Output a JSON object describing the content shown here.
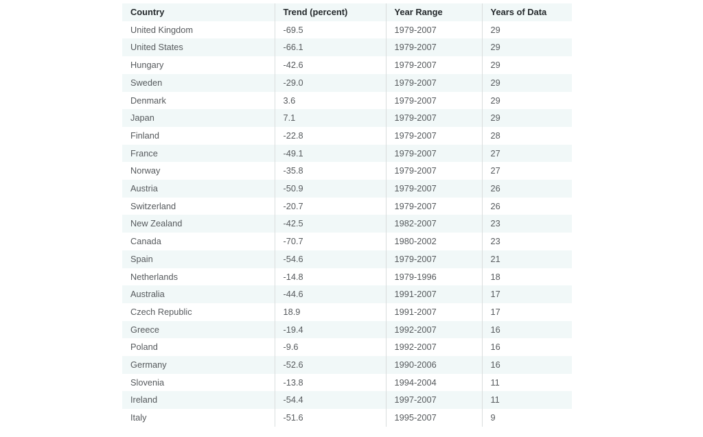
{
  "table": {
    "columns": [
      {
        "key": "country",
        "label": "Country"
      },
      {
        "key": "trend",
        "label": "Trend (percent)"
      },
      {
        "key": "range",
        "label": "Year Range"
      },
      {
        "key": "years",
        "label": "Years of Data"
      }
    ],
    "rows": [
      {
        "country": "United Kingdom",
        "trend": "-69.5",
        "range": "1979-2007",
        "years": "29"
      },
      {
        "country": "United States",
        "trend": "-66.1",
        "range": "1979-2007",
        "years": "29"
      },
      {
        "country": "Hungary",
        "trend": "-42.6",
        "range": "1979-2007",
        "years": "29"
      },
      {
        "country": "Sweden",
        "trend": "-29.0",
        "range": "1979-2007",
        "years": "29"
      },
      {
        "country": "Denmark",
        "trend": "3.6",
        "range": "1979-2007",
        "years": "29"
      },
      {
        "country": "Japan",
        "trend": "7.1",
        "range": "1979-2007",
        "years": "29"
      },
      {
        "country": "Finland",
        "trend": "-22.8",
        "range": "1979-2007",
        "years": "28"
      },
      {
        "country": "France",
        "trend": "-49.1",
        "range": "1979-2007",
        "years": "27"
      },
      {
        "country": "Norway",
        "trend": "-35.8",
        "range": "1979-2007",
        "years": "27"
      },
      {
        "country": "Austria",
        "trend": "-50.9",
        "range": "1979-2007",
        "years": "26"
      },
      {
        "country": "Switzerland",
        "trend": "-20.7",
        "range": "1979-2007",
        "years": "26"
      },
      {
        "country": "New Zealand",
        "trend": "-42.5",
        "range": "1982-2007",
        "years": "23"
      },
      {
        "country": "Canada",
        "trend": "-70.7",
        "range": "1980-2002",
        "years": "23"
      },
      {
        "country": "Spain",
        "trend": "-54.6",
        "range": "1979-2007",
        "years": "21"
      },
      {
        "country": "Netherlands",
        "trend": "-14.8",
        "range": "1979-1996",
        "years": "18"
      },
      {
        "country": "Australia",
        "trend": "-44.6",
        "range": "1991-2007",
        "years": "17"
      },
      {
        "country": "Czech Republic",
        "trend": "18.9",
        "range": "1991-2007",
        "years": "17"
      },
      {
        "country": "Greece",
        "trend": "-19.4",
        "range": "1992-2007",
        "years": "16"
      },
      {
        "country": "Poland",
        "trend": "-9.6",
        "range": "1992-2007",
        "years": "16"
      },
      {
        "country": "Germany",
        "trend": "-52.6",
        "range": "1990-2006",
        "years": "16"
      },
      {
        "country": "Slovenia",
        "trend": "-13.8",
        "range": "1994-2004",
        "years": "11"
      },
      {
        "country": "Ireland",
        "trend": "-54.4",
        "range": "1997-2007",
        "years": "11"
      },
      {
        "country": "Italy",
        "trend": "-51.6",
        "range": "1995-2007",
        "years": "9"
      }
    ]
  },
  "chart_data": {
    "type": "table",
    "title": "",
    "columns": [
      "Country",
      "Trend (percent)",
      "Year Range",
      "Years of Data"
    ],
    "categories": [
      "United Kingdom",
      "United States",
      "Hungary",
      "Sweden",
      "Denmark",
      "Japan",
      "Finland",
      "France",
      "Norway",
      "Austria",
      "Switzerland",
      "New Zealand",
      "Canada",
      "Spain",
      "Netherlands",
      "Australia",
      "Czech Republic",
      "Greece",
      "Poland",
      "Germany",
      "Slovenia",
      "Ireland",
      "Italy"
    ],
    "series": [
      {
        "name": "Trend (percent)",
        "values": [
          -69.5,
          -66.1,
          -42.6,
          -29.0,
          3.6,
          7.1,
          -22.8,
          -49.1,
          -35.8,
          -50.9,
          -20.7,
          -42.5,
          -70.7,
          -54.6,
          -14.8,
          -44.6,
          18.9,
          -19.4,
          -9.6,
          -52.6,
          -13.8,
          -54.4,
          -51.6
        ]
      },
      {
        "name": "Years of Data",
        "values": [
          29,
          29,
          29,
          29,
          29,
          29,
          28,
          27,
          27,
          26,
          26,
          23,
          23,
          21,
          18,
          17,
          17,
          16,
          16,
          16,
          11,
          11,
          9
        ]
      }
    ],
    "year_ranges": [
      "1979-2007",
      "1979-2007",
      "1979-2007",
      "1979-2007",
      "1979-2007",
      "1979-2007",
      "1979-2007",
      "1979-2007",
      "1979-2007",
      "1979-2007",
      "1979-2007",
      "1982-2007",
      "1980-2002",
      "1979-2007",
      "1979-1996",
      "1991-2007",
      "1991-2007",
      "1992-2007",
      "1992-2007",
      "1990-2006",
      "1994-2004",
      "1997-2007",
      "1995-2007"
    ],
    "grid": false,
    "legend": "none"
  },
  "style": {
    "stripe_color": "#f1f8f8",
    "base_color": "#ffffff",
    "divider_color": "#d9dddd",
    "header_text_color": "#23282b",
    "body_text_color": "#55595c"
  }
}
